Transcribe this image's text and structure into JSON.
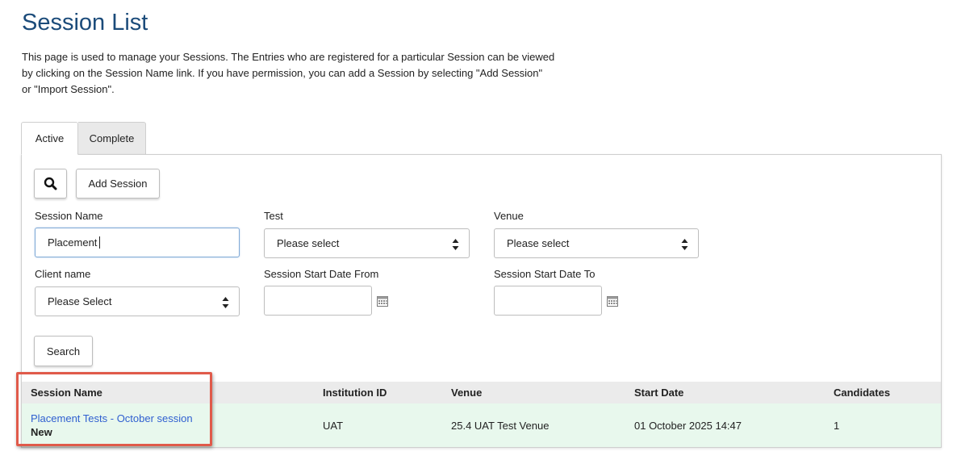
{
  "page": {
    "title": "Session List",
    "intro_line1": "This page is used to manage your Sessions. The Entries who are registered for a particular Session can be viewed",
    "intro_line2": "by clicking on the Session Name link. If you have permission, you can add a Session by selecting \"Add Session\"",
    "intro_line3": "or \"Import Session\"."
  },
  "tabs": [
    {
      "label": "Active",
      "active": true
    },
    {
      "label": "Complete",
      "active": false
    }
  ],
  "toolbar": {
    "search_icon": "search-icon",
    "add_session_label": "Add Session"
  },
  "filters": {
    "session_name": {
      "label": "Session Name",
      "value": "Placement"
    },
    "test": {
      "label": "Test",
      "value": "Please select"
    },
    "venue": {
      "label": "Venue",
      "value": "Please select"
    },
    "client_name": {
      "label": "Client name",
      "value": "Please Select"
    },
    "start_from": {
      "label": "Session Start Date From",
      "value": ""
    },
    "start_to": {
      "label": "Session Start Date To",
      "value": ""
    },
    "search_label": "Search"
  },
  "table": {
    "columns": [
      "Session Name",
      "Institution ID",
      "Venue",
      "Start Date",
      "Candidates"
    ],
    "rows": [
      {
        "session_name": "Placement Tests - October session",
        "status": "New",
        "institution_id": "UAT",
        "venue": "25.4 UAT Test Venue",
        "start_date": "01 October 2025 14:47",
        "candidates": "1"
      }
    ]
  },
  "colors": {
    "title": "#1b4b7a",
    "link": "#2f5fd0",
    "row_highlight": "#e8f8ed",
    "annotation_box": "#e05a4a"
  }
}
